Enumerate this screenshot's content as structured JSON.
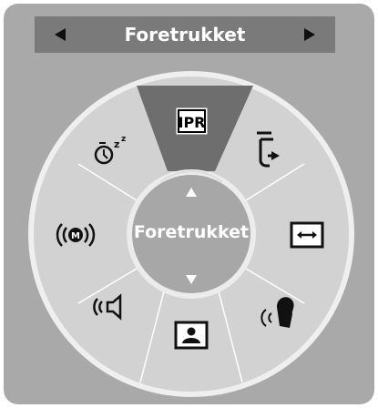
{
  "header": {
    "title": "Foretrukket"
  },
  "center": {
    "title": "Foretrukket"
  },
  "colors": {
    "panel": "#a9a9a9",
    "header": "#7a7a7a",
    "ring": "#d2d2d2",
    "selected": "#6e6e6e",
    "center": "#a7a7a7"
  },
  "items": [
    {
      "id": "picture-mode",
      "icon": "ipr-icon",
      "label": "IPR",
      "selected": true
    },
    {
      "id": "input",
      "icon": "input-arrow-icon"
    },
    {
      "id": "aspect-ratio",
      "icon": "aspect-ratio-icon"
    },
    {
      "id": "voice",
      "icon": "voice-icon"
    },
    {
      "id": "picture",
      "icon": "picture-icon"
    },
    {
      "id": "sound",
      "icon": "speaker-icon"
    },
    {
      "id": "mode-m",
      "icon": "m-signal-icon",
      "label": "M"
    },
    {
      "id": "sleep-timer",
      "icon": "sleep-timer-icon",
      "label": "z"
    }
  ]
}
